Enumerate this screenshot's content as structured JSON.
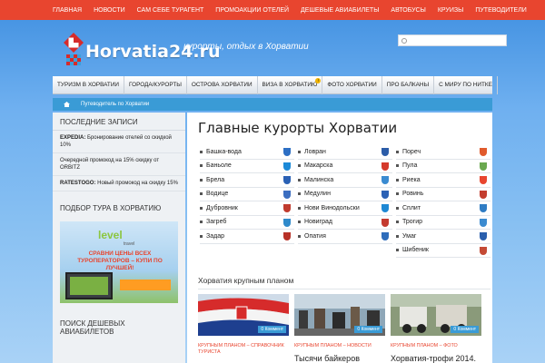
{
  "topnav": [
    "ГЛАВНАЯ",
    "НОВОСТИ",
    "САМ СЕБЕ ТУРАГЕНТ",
    "ПРОМОАКЦИИ ОТЕЛЕЙ",
    "ДЕШЕВЫЕ АВИАБИЛЕТЫ",
    "АВТОБУСЫ",
    "КРУИЗЫ",
    "ПУТЕВОДИТЕЛИ"
  ],
  "header": {
    "logo_text": "Horvatia24.ru",
    "tagline": "курорты, отдых в Хорватии"
  },
  "mainnav": [
    {
      "label": "ТУРИЗМ В ХОРВАТИИ"
    },
    {
      "label": "ГОРОДА/КУРОРТЫ"
    },
    {
      "label": "ОСТРОВА ХОРВАТИИ"
    },
    {
      "label": "ВИЗА В ХОРВАТИЮ",
      "badge": "!"
    },
    {
      "label": "ФОТО ХОРВАТИИ"
    },
    {
      "label": "ПРО БАЛКАНЫ"
    },
    {
      "label": "С МИРУ ПО НИТКЕ"
    }
  ],
  "breadcrumb": "Путеводитель по Хорватии",
  "sidebar": {
    "recent_heading": "ПОСЛЕДНИЕ ЗАПИСИ",
    "posts": [
      {
        "bold": "EXPEDIA:",
        "text": " Бронирование отелей со скидкой 10%"
      },
      {
        "bold": "",
        "text": "Очередной промокод на 15% скидку от ORBITZ"
      },
      {
        "bold": "RATESTOGO:",
        "text": " Новый промокод на скидку 15%"
      }
    ],
    "tour_heading": "ПОДБОР ТУРА В ХОРВАТИЮ",
    "ad": {
      "logo_a": "level",
      "logo_b": "travel",
      "slogan": "СРАВНИ ЦЕНЫ ВСЕХ ТУРОПЕРАТОРОВ – КУПИ ПО ЛУЧШЕЙ!"
    },
    "flights_heading": "ПОИСК ДЕШЕВЫХ АВИАБИЛЕТОВ"
  },
  "main": {
    "title": "Главные курорты Хорватии",
    "resorts": [
      [
        {
          "name": "Башка-вода",
          "color": "#2d6fc4"
        },
        {
          "name": "Баньоле",
          "color": "#1c8ad8"
        },
        {
          "name": "Брела",
          "color": "#2a61b5"
        },
        {
          "name": "Водице",
          "color": "#3c6ec0"
        },
        {
          "name": "Дубровник",
          "color": "#c03b2e"
        },
        {
          "name": "Загреб",
          "color": "#2f8acb"
        },
        {
          "name": "Задар",
          "color": "#b83228"
        }
      ],
      [
        {
          "name": "Ловран",
          "color": "#2b5ca8"
        },
        {
          "name": "Макарска",
          "color": "#d53a2c"
        },
        {
          "name": "Малинска",
          "color": "#3a8bd1"
        },
        {
          "name": "Медулин",
          "color": "#2c62b5"
        },
        {
          "name": "Нови Винодольски",
          "color": "#1e88d4"
        },
        {
          "name": "Новиград",
          "color": "#c43a2f"
        },
        {
          "name": "Опатия",
          "color": "#2f6dbb"
        }
      ],
      [
        {
          "name": "Пореч",
          "color": "#e05a2c"
        },
        {
          "name": "Пула",
          "color": "#6aa84f"
        },
        {
          "name": "Риека",
          "color": "#e8452f"
        },
        {
          "name": "Ровинь",
          "color": "#c33d2f"
        },
        {
          "name": "Сплит",
          "color": "#2f7cc4"
        },
        {
          "name": "Трогир",
          "color": "#3a8ad0"
        },
        {
          "name": "Умаг",
          "color": "#2a5fad"
        },
        {
          "name": "Шибеник",
          "color": "#c44a35"
        }
      ]
    ],
    "section_heading": "Хорватия крупным планом",
    "posts": [
      {
        "comments": "0 Коммент",
        "category": "КРУПНЫМ ПЛАНОМ – СПРАВОЧНИК ТУРИСТА",
        "title": ""
      },
      {
        "comments": "0 Коммент",
        "category": "КРУПНЫМ ПЛАНОМ – НОВОСТИ",
        "title": "Тысячи байкеров"
      },
      {
        "comments": "0 Коммент",
        "category": "КРУПНЫМ ПЛАНОМ – ФОТО",
        "title": "Хорватия-трофи 2014."
      }
    ]
  }
}
